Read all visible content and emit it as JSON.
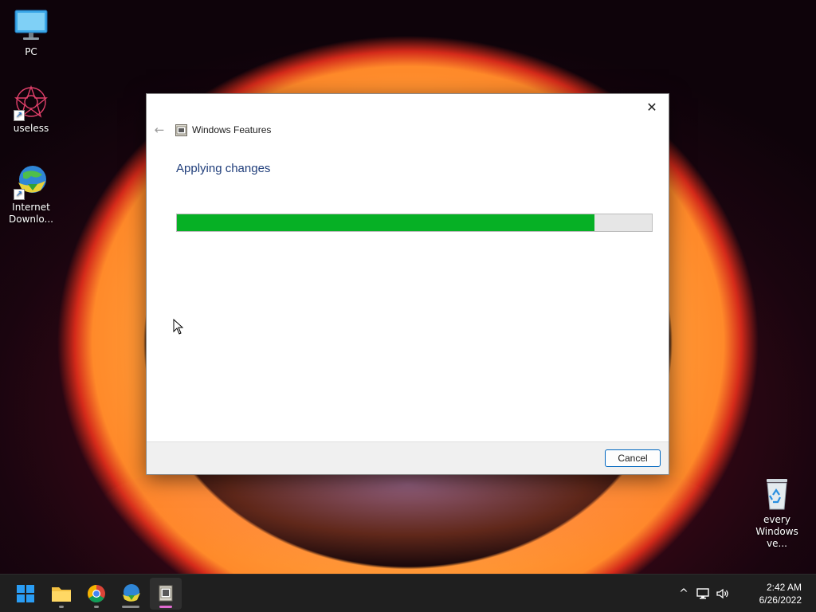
{
  "desktop": {
    "icons": [
      {
        "label": "PC"
      },
      {
        "label": "useless"
      },
      {
        "label": "Internet Downlo..."
      },
      {
        "label": "every Windows ve..."
      }
    ]
  },
  "dialog": {
    "title": "Windows Features",
    "heading": "Applying changes",
    "progress": 0.88,
    "cancel_label": "Cancel",
    "close_glyph": "✕",
    "back_glyph": "←"
  },
  "taskbar": {
    "apps": [
      "start-icon",
      "file-explorer-icon",
      "chrome-icon",
      "internet-download-manager-icon",
      "windows-features-icon"
    ],
    "tray": {
      "chevron": "^",
      "time": "2:42 AM",
      "date": "6/26/2022"
    }
  },
  "colors": {
    "progress_fill": "#06b025",
    "heading": "#1f3d7a",
    "accent": "#0067c0"
  }
}
